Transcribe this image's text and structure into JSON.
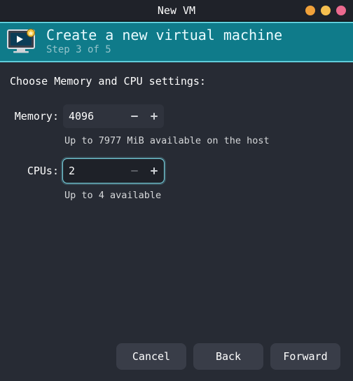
{
  "window": {
    "title": "New VM"
  },
  "header": {
    "title": "Create a new virtual machine",
    "step": "Step 3 of 5"
  },
  "prompt": "Choose Memory and CPU settings:",
  "memory": {
    "label": "Memory:",
    "value": "4096",
    "hint": "Up to 7977 MiB available on the host",
    "decrement_enabled": true,
    "increment_enabled": true
  },
  "cpus": {
    "label": "CPUs:",
    "value": "2",
    "hint": "Up to 4 available",
    "decrement_enabled": false,
    "increment_enabled": true,
    "focused": true
  },
  "buttons": {
    "cancel": "Cancel",
    "back": "Back",
    "forward": "Forward"
  },
  "icons": {
    "minus": "minus-icon",
    "plus": "plus-icon",
    "vm": "vm-monitor-icon"
  }
}
